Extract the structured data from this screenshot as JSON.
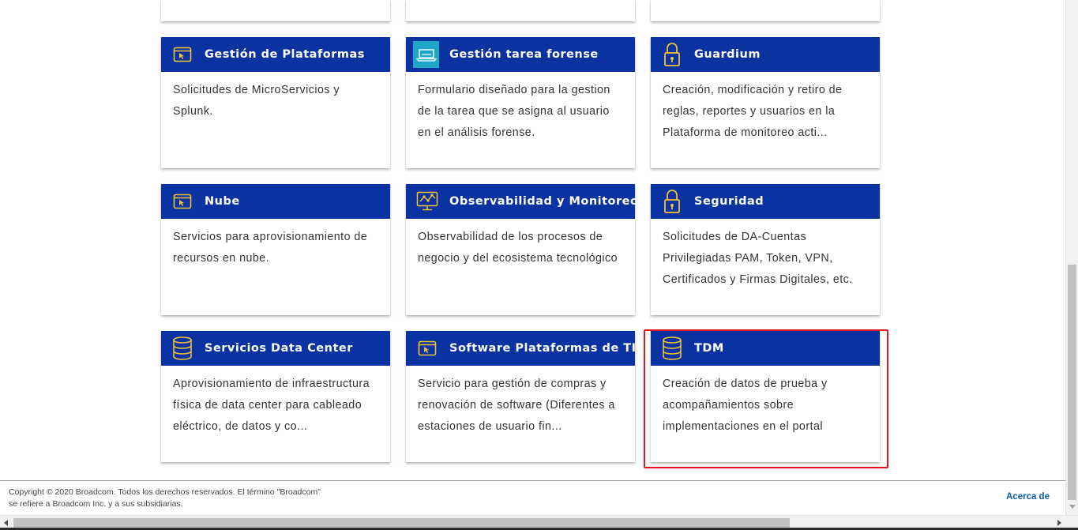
{
  "colors": {
    "header_bg": "#0a32a0",
    "icon_accent": "#f2c230",
    "highlight_border": "#e0171d",
    "link": "#0b5aa8"
  },
  "cards": [
    {
      "title": "Gestión de Plataformas",
      "description": "Solicitudes de MicroServicios y Splunk.",
      "icon": "window-cursor-icon"
    },
    {
      "title": "Gestión tarea forense",
      "description": "Formulario diseñado para la gestion de la tarea que se asigna al usuario en el análisis forense.",
      "icon": "laptop-icon"
    },
    {
      "title": "Guardium",
      "description": "Creación, modificación y retiro de reglas, reportes y usuarios en la Plataforma de monitoreo acti...",
      "icon": "padlock-icon"
    },
    {
      "title": "Nube",
      "description": "Servicios para aprovisionamiento de recursos en nube.",
      "icon": "window-cursor-icon"
    },
    {
      "title": "Observabilidad y Monitoreo",
      "description": "Observabilidad de los procesos de negocio y del ecosistema tecnológico",
      "icon": "monitor-chart-icon"
    },
    {
      "title": "Seguridad",
      "description": "Solicitudes de DA-Cuentas Privilegiadas PAM, Token, VPN, Certificados y Firmas Digitales, etc.",
      "icon": "padlock-icon"
    },
    {
      "title": "Servicios Data Center",
      "description": "Aprovisionamiento de infraestructura física de data center para cableado eléctrico, de datos y co...",
      "icon": "database-icon"
    },
    {
      "title": "Software Plataformas de TI",
      "description": "Servicio para gestión de compras y renovación de software (Diferentes a estaciones de usuario fin...",
      "icon": "window-cursor-icon"
    },
    {
      "title": "TDM",
      "description": "Creación de datos de prueba y acompañamientos sobre implementaciones en el portal",
      "icon": "database-icon"
    }
  ],
  "footer": {
    "copyright_line1": "Copyright © 2020 Broadcom. Todos los derechos reservados. El término \"Broadcom\"",
    "copyright_line2": "se refiere a Broadcom Inc. y a sus subsidiarias.",
    "about_link": "Acerca de"
  }
}
